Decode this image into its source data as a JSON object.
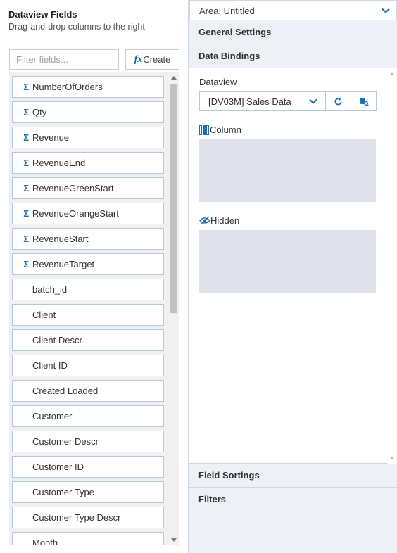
{
  "left_panel": {
    "title": "Dataview Fields",
    "subtitle": "Drag-and-drop columns to the right",
    "filter_placeholder": "Filter fields...",
    "create_label": "Create",
    "fields": [
      {
        "label": "NumberOfOrders",
        "measure": true
      },
      {
        "label": "Qty",
        "measure": true
      },
      {
        "label": "Revenue",
        "measure": true
      },
      {
        "label": "RevenueEnd",
        "measure": true
      },
      {
        "label": "RevenueGreenStart",
        "measure": true
      },
      {
        "label": "RevenueOrangeStart",
        "measure": true
      },
      {
        "label": "RevenueStart",
        "measure": true
      },
      {
        "label": "RevenueTarget",
        "measure": true
      },
      {
        "label": "batch_id",
        "measure": false
      },
      {
        "label": "Client",
        "measure": false
      },
      {
        "label": "Client Descr",
        "measure": false
      },
      {
        "label": "Client ID",
        "measure": false
      },
      {
        "label": "Created Loaded",
        "measure": false
      },
      {
        "label": "Customer",
        "measure": false
      },
      {
        "label": "Customer Descr",
        "measure": false
      },
      {
        "label": "Customer ID",
        "measure": false
      },
      {
        "label": "Customer Type",
        "measure": false
      },
      {
        "label": "Customer Type Descr",
        "measure": false
      },
      {
        "label": "Month",
        "measure": false
      }
    ]
  },
  "right_panel": {
    "area_label": "Area: Untitled",
    "general_settings": "General Settings",
    "data_bindings": "Data Bindings",
    "dataview_label": "Dataview",
    "dataview_value": "[DV03M] Sales Data",
    "column_label": "Column",
    "hidden_label": "Hidden",
    "field_sortings": "Field Sortings",
    "filters": "Filters"
  },
  "colors": {
    "accent": "#1a6fb0",
    "drop_zone": "#dfe2ea",
    "panel_bg": "#eef1f5",
    "border": "#cfd8e3"
  }
}
